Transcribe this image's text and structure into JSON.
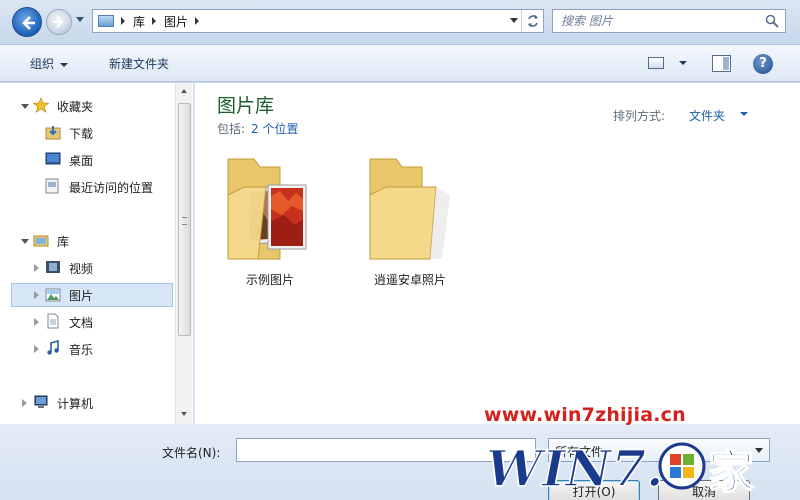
{
  "address_bar": {
    "breadcrumbs": [
      "库",
      "图片"
    ],
    "search_placeholder": "搜索 图片"
  },
  "toolbar": {
    "organize_label": "组织",
    "new_folder_label": "新建文件夹"
  },
  "nav_pane": {
    "items": [
      {
        "label": "收藏夹",
        "icon": "star-icon",
        "expanded": true
      },
      {
        "label": "下载",
        "icon": "downloads-folder-icon"
      },
      {
        "label": "桌面",
        "icon": "desktop-icon"
      },
      {
        "label": "最近访问的位置",
        "icon": "recent-places-icon"
      },
      {
        "label": "库",
        "icon": "library-icon",
        "expanded": true
      },
      {
        "label": "视频",
        "icon": "videos-icon",
        "expanded": false
      },
      {
        "label": "图片",
        "icon": "pictures-icon",
        "expanded": false,
        "selected": true
      },
      {
        "label": "文档",
        "icon": "documents-icon",
        "expanded": false
      },
      {
        "label": "音乐",
        "icon": "music-icon",
        "expanded": false
      },
      {
        "label": "计算机",
        "icon": "computer-icon",
        "expanded": false
      }
    ]
  },
  "content": {
    "title": "图片库",
    "includes_label": "包括:",
    "includes_link": "2 个位置",
    "arrange_label": "排列方式:",
    "arrange_value": "文件夹",
    "folders": [
      {
        "label": "示例图片",
        "icon": "sample-pictures-folder-icon"
      },
      {
        "label": "逍遥安卓照片",
        "icon": "folder-icon"
      }
    ]
  },
  "bottom": {
    "filename_label": "文件名(N):",
    "filename_value": "",
    "filetype_value": "所有文件",
    "open_label": "打开(O)",
    "cancel_label": "取消"
  },
  "watermark": {
    "url": "www.win7zhijia.cn",
    "logo_text": "WIN7.之家"
  },
  "colors": {
    "title_green": "#1e5d2f",
    "link_blue": "#1e5fb0",
    "watermark_red": "#d3231f",
    "watermark_blue": "#1a3a8c"
  }
}
